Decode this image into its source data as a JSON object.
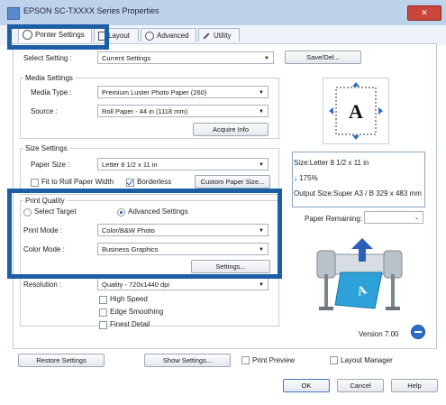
{
  "window": {
    "title": "EPSON SC-TXXXX Series Properties",
    "close_glyph": "✕"
  },
  "tabs": [
    {
      "label": "Printer Settings"
    },
    {
      "label": "Layout"
    },
    {
      "label": "Advanced"
    },
    {
      "label": "Utility"
    }
  ],
  "select_setting": {
    "label": "Select Setting :",
    "value": "Current Settings",
    "save_label": "Save/Del..."
  },
  "media": {
    "group": "Media Settings",
    "type_label": "Media Type :",
    "type_value": "Premium Luster Photo Paper (260)",
    "source_label": "Source :",
    "source_value": "Roll Paper - 44 in (1118 mm)",
    "acquire_label": "Acquire Info"
  },
  "size": {
    "group": "Size Settings",
    "paper_label": "Paper Size :",
    "paper_value": "Letter 8 1/2 x 11 in",
    "fit_label": "Fit to Roll Paper Width",
    "borderless_label": "Borderless",
    "custom_label": "Custom Paper Size..."
  },
  "quality": {
    "group": "Print Quality",
    "select_target_label": "Select Target",
    "advanced_label": "Advanced Settings",
    "print_mode_label": "Print Mode :",
    "print_mode_value": "Color/B&W Photo",
    "color_mode_label": "Color Mode :",
    "color_mode_value": "Business Graphics",
    "settings_label": "Settings...",
    "resolution_label": "Resolution :",
    "resolution_value": "Quality - 720x1440 dpi",
    "high_speed_label": "High Speed",
    "edge_smoothing_label": "Edge Smoothing",
    "finest_detail_label": "Finest Detail"
  },
  "info": {
    "size_line": "Size:Letter 8 1/2 x 11 in",
    "scale_line": "175%",
    "output_line": "Output Size:Super A3 / B 329 x 483 mm",
    "paper_remaining_label": "Paper Remaining:",
    "version": "Version 7.00"
  },
  "footer": {
    "restore_label": "Restore Settings",
    "show_label": "Show Settings...",
    "preview_label": "Print Preview",
    "layout_mgr_label": "Layout Manager",
    "ok_label": "OK",
    "cancel_label": "Cancel",
    "help_label": "Help"
  },
  "colors": {
    "highlight": "#1d5fa6",
    "titlebar": "#bdd3ec",
    "close": "#c9463d"
  }
}
